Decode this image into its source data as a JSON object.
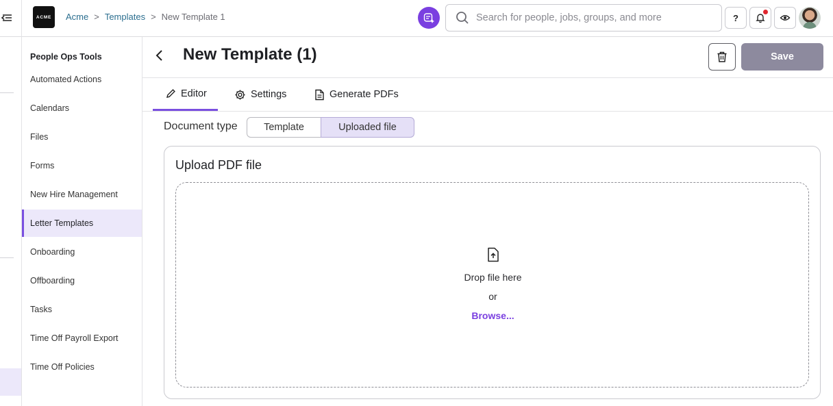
{
  "app": {
    "logo_text": "ACME",
    "breadcrumb": [
      "Acme",
      "Templates",
      "New Template 1"
    ],
    "breadcrumb_sep": ">"
  },
  "search": {
    "placeholder": "Search for people, jobs, groups, and more"
  },
  "topbar": {
    "help_label": "?"
  },
  "icons": {
    "collapse": "collapse-menu-icon",
    "ai": "sparkle-ai-icon",
    "search": "search-icon",
    "help": "question-mark-icon",
    "notifications": "bell-icon",
    "preview": "eye-icon",
    "back": "chevron-left-icon",
    "delete": "trash-icon",
    "editor": "pencil-icon",
    "settings": "gear-icon",
    "pdf": "document-icon",
    "upload": "file-upload-icon"
  },
  "colors": {
    "accent": "#7a3fe0",
    "active_bg": "#ece8fa",
    "save_disabled": "#8d8a9e",
    "notification": "#e0262f"
  },
  "sidebar": {
    "title": "People Ops Tools",
    "items": [
      {
        "label": "Automated Actions",
        "active": false
      },
      {
        "label": "Calendars",
        "active": false
      },
      {
        "label": "Files",
        "active": false
      },
      {
        "label": "Forms",
        "active": false
      },
      {
        "label": "New Hire Management",
        "active": false
      },
      {
        "label": "Letter Templates",
        "active": true
      },
      {
        "label": "Onboarding",
        "active": false
      },
      {
        "label": "Offboarding",
        "active": false
      },
      {
        "label": "Tasks",
        "active": false
      },
      {
        "label": "Time Off Payroll Export",
        "active": false
      },
      {
        "label": "Time Off Policies",
        "active": false
      }
    ]
  },
  "main": {
    "title": "New Template (1)",
    "save_label": "Save",
    "tabs": [
      {
        "label": "Editor",
        "active": true
      },
      {
        "label": "Settings",
        "active": false
      },
      {
        "label": "Generate PDFs",
        "active": false
      }
    ],
    "document_type": {
      "label": "Document type",
      "options": [
        "Template",
        "Uploaded file"
      ],
      "selected": "Uploaded file"
    },
    "upload": {
      "title": "Upload PDF file",
      "drop_text": "Drop file here",
      "or_text": "or",
      "browse_label": "Browse..."
    }
  }
}
